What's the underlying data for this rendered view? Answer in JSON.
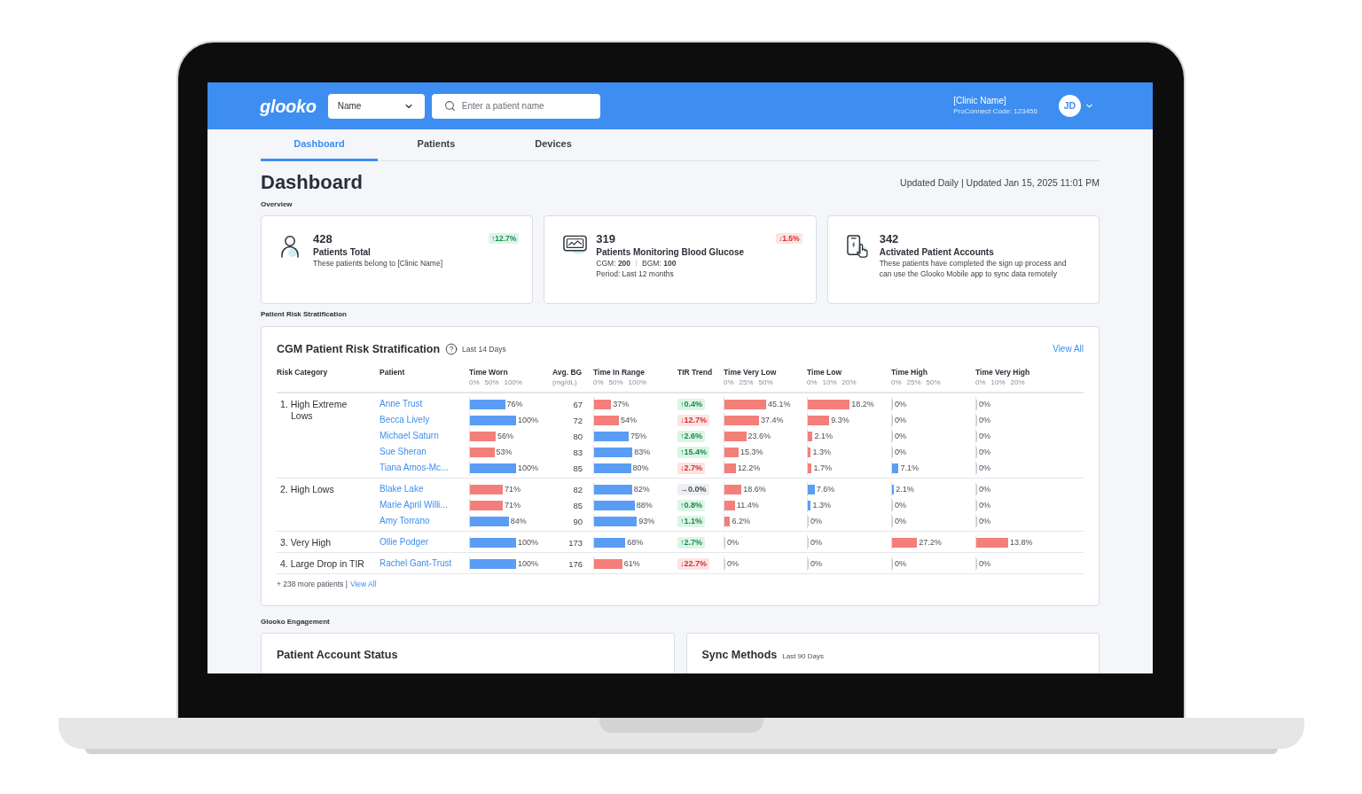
{
  "header": {
    "logo": "glooko",
    "search_by": {
      "value": "Name"
    },
    "search": {
      "placeholder": "Enter a patient name"
    },
    "clinic": {
      "name": "[Clinic Name]",
      "code": "ProConnect Code: 123456"
    },
    "avatar": "JD"
  },
  "tabs": [
    {
      "label": "Dashboard",
      "selected": true
    },
    {
      "label": "Patients",
      "selected": false
    },
    {
      "label": "Devices",
      "selected": false
    }
  ],
  "page": {
    "title": "Dashboard",
    "updated": "Updated Daily | Updated Jan 15, 2025 11:01 PM"
  },
  "overview": {
    "heading": "Overview",
    "cards": [
      {
        "value": "428",
        "title": "Patients Total",
        "description": "These patients belong to [Clinic Name]",
        "change": {
          "text": "↑12.7%",
          "kind": "rise"
        }
      },
      {
        "value": "319",
        "title": "Patients Monitoring Blood Glucose",
        "stats": [
          "CGM: **200**",
          "BGM: **100**"
        ],
        "description": "Period: Last 12 months",
        "change": {
          "text": "↓1.5%",
          "kind": "drop"
        }
      },
      {
        "value": "342",
        "title": "Activated Patient Accounts",
        "description": "These patients have completed the sign up process and can use the Glooko Mobile app to sync data remotely"
      }
    ]
  },
  "risk_heading": "Patient Risk Stratification",
  "risk_table": {
    "title": "CGM Patient Risk Stratification",
    "period": "Last 14 Days",
    "view_all": "View All",
    "columns": [
      {
        "label": "Risk Category"
      },
      {
        "label": "Patient"
      },
      {
        "label": "Time Worn",
        "scale": [
          "0%",
          "50%",
          "100%"
        ]
      },
      {
        "label": "Avg. BG",
        "unit": "(mg/dL)"
      },
      {
        "label": "Time In Range",
        "scale": [
          "0%",
          "50%",
          "100%"
        ]
      },
      {
        "label": "TIR Trend"
      },
      {
        "label": "Time Very Low",
        "scale": [
          "0%",
          "25%",
          "50%"
        ]
      },
      {
        "label": "Time Low",
        "scale": [
          "0%",
          "10%",
          "20%"
        ]
      },
      {
        "label": "Time High",
        "scale": [
          "0%",
          "25%",
          "50%"
        ]
      },
      {
        "label": "Time Very High",
        "scale": [
          "0%",
          "10%",
          "20%"
        ]
      }
    ],
    "groups": [
      {
        "category": "1. High Extreme Lows",
        "patients": [
          {
            "name": "Anne Trust",
            "metrics": [
              {
                "kind": "bar",
                "reading": "76%",
                "level": 0.76,
                "alert": false
              },
              {
                "kind": "number",
                "text": "67"
              },
              {
                "kind": "bar",
                "reading": "37%",
                "level": 0.37,
                "alert": true
              },
              {
                "kind": "rise",
                "text": "↑0.4%"
              },
              {
                "kind": "bar",
                "reading": "45.1%",
                "level": 0.902,
                "alert": true
              },
              {
                "kind": "bar",
                "reading": "18.2%",
                "level": 0.91,
                "alert": true
              },
              {
                "kind": "bar",
                "reading": "0%",
                "level": 0
              },
              {
                "kind": "bar",
                "reading": "0%",
                "level": 0
              }
            ]
          },
          {
            "name": "Becca Lively",
            "metrics": [
              {
                "kind": "bar",
                "reading": "100%",
                "level": 1,
                "alert": false
              },
              {
                "kind": "number",
                "text": "72"
              },
              {
                "kind": "bar",
                "reading": "54%",
                "level": 0.54,
                "alert": true
              },
              {
                "kind": "drop",
                "text": "↓12.7%"
              },
              {
                "kind": "bar",
                "reading": "37.4%",
                "level": 0.748,
                "alert": true
              },
              {
                "kind": "bar",
                "reading": "9.3%",
                "level": 0.465,
                "alert": true
              },
              {
                "kind": "bar",
                "reading": "0%",
                "level": 0
              },
              {
                "kind": "bar",
                "reading": "0%",
                "level": 0
              }
            ]
          },
          {
            "name": "Michael Saturn",
            "metrics": [
              {
                "kind": "bar",
                "reading": "56%",
                "level": 0.56,
                "alert": true
              },
              {
                "kind": "number",
                "text": "80"
              },
              {
                "kind": "bar",
                "reading": "75%",
                "level": 0.75,
                "alert": false
              },
              {
                "kind": "rise",
                "text": "↑2.6%"
              },
              {
                "kind": "bar",
                "reading": "23.6%",
                "level": 0.472,
                "alert": true
              },
              {
                "kind": "bar",
                "reading": "2.1%",
                "level": 0.105,
                "alert": true
              },
              {
                "kind": "bar",
                "reading": "0%",
                "level": 0
              },
              {
                "kind": "bar",
                "reading": "0%",
                "level": 0
              }
            ]
          },
          {
            "name": "Sue Sheran",
            "metrics": [
              {
                "kind": "bar",
                "reading": "53%",
                "level": 0.53,
                "alert": true
              },
              {
                "kind": "number",
                "text": "83"
              },
              {
                "kind": "bar",
                "reading": "83%",
                "level": 0.83,
                "alert": false
              },
              {
                "kind": "rise",
                "text": "↑15.4%"
              },
              {
                "kind": "bar",
                "reading": "15.3%",
                "level": 0.306,
                "alert": true
              },
              {
                "kind": "bar",
                "reading": "1.3%",
                "level": 0.065,
                "alert": true
              },
              {
                "kind": "bar",
                "reading": "0%",
                "level": 0
              },
              {
                "kind": "bar",
                "reading": "0%",
                "level": 0
              }
            ]
          },
          {
            "name": "Tiana Amos-Mc...",
            "metrics": [
              {
                "kind": "bar",
                "reading": "100%",
                "level": 1,
                "alert": false
              },
              {
                "kind": "number",
                "text": "85"
              },
              {
                "kind": "bar",
                "reading": "80%",
                "level": 0.8,
                "alert": false
              },
              {
                "kind": "drop",
                "text": "↓2.7%"
              },
              {
                "kind": "bar",
                "reading": "12.2%",
                "level": 0.244,
                "alert": true
              },
              {
                "kind": "bar",
                "reading": "1.7%",
                "level": 0.085,
                "alert": true
              },
              {
                "kind": "bar",
                "reading": "7.1%",
                "level": 0.142,
                "alert": false
              },
              {
                "kind": "bar",
                "reading": "0%",
                "level": 0
              }
            ]
          }
        ]
      },
      {
        "category": "2. High Lows",
        "patients": [
          {
            "name": "Blake Lake",
            "metrics": [
              {
                "kind": "bar",
                "reading": "71%",
                "level": 0.71,
                "alert": true
              },
              {
                "kind": "number",
                "text": "82"
              },
              {
                "kind": "bar",
                "reading": "82%",
                "level": 0.82,
                "alert": false
              },
              {
                "kind": "steady",
                "text": "→0.0%"
              },
              {
                "kind": "bar",
                "reading": "18.6%",
                "level": 0.372,
                "alert": true
              },
              {
                "kind": "bar",
                "reading": "7.6%",
                "level": 0.15,
                "alert": false
              },
              {
                "kind": "bar",
                "reading": "2.1%",
                "level": 0.042,
                "alert": false
              },
              {
                "kind": "bar",
                "reading": "0%",
                "level": 0
              }
            ]
          },
          {
            "name": "Marie April Willi...",
            "metrics": [
              {
                "kind": "bar",
                "reading": "71%",
                "level": 0.71,
                "alert": true
              },
              {
                "kind": "number",
                "text": "85"
              },
              {
                "kind": "bar",
                "reading": "88%",
                "level": 0.88,
                "alert": false
              },
              {
                "kind": "rise",
                "text": "↑0.8%"
              },
              {
                "kind": "bar",
                "reading": "11.4%",
                "level": 0.228,
                "alert": true
              },
              {
                "kind": "bar",
                "reading": "1.3%",
                "level": 0.065,
                "alert": false
              },
              {
                "kind": "bar",
                "reading": "0%",
                "level": 0
              },
              {
                "kind": "bar",
                "reading": "0%",
                "level": 0
              }
            ]
          },
          {
            "name": "Amy Torrano",
            "metrics": [
              {
                "kind": "bar",
                "reading": "84%",
                "level": 0.84,
                "alert": false
              },
              {
                "kind": "number",
                "text": "90"
              },
              {
                "kind": "bar",
                "reading": "93%",
                "level": 0.93,
                "alert": false
              },
              {
                "kind": "rise",
                "text": "↑1.1%"
              },
              {
                "kind": "bar",
                "reading": "6.2%",
                "level": 0.124,
                "alert": true
              },
              {
                "kind": "bar",
                "reading": "0%",
                "level": 0
              },
              {
                "kind": "bar",
                "reading": "0%",
                "level": 0
              },
              {
                "kind": "bar",
                "reading": "0%",
                "level": 0
              }
            ]
          }
        ]
      },
      {
        "category": "3. Very High",
        "patients": [
          {
            "name": "Ollie Podger",
            "metrics": [
              {
                "kind": "bar",
                "reading": "100%",
                "level": 1,
                "alert": false
              },
              {
                "kind": "number",
                "text": "173"
              },
              {
                "kind": "bar",
                "reading": "68%",
                "level": 0.68,
                "alert": false
              },
              {
                "kind": "rise",
                "text": "↑2.7%"
              },
              {
                "kind": "bar",
                "reading": "0%",
                "level": 0
              },
              {
                "kind": "bar",
                "reading": "0%",
                "level": 0
              },
              {
                "kind": "bar",
                "reading": "27.2%",
                "level": 0.544,
                "alert": true
              },
              {
                "kind": "bar",
                "reading": "13.8%",
                "level": 0.69,
                "alert": true
              }
            ]
          }
        ]
      },
      {
        "category": "4. Large Drop in TIR",
        "patients": [
          {
            "name": "Rachel Gant-Trust",
            "metrics": [
              {
                "kind": "bar",
                "reading": "100%",
                "level": 1,
                "alert": false
              },
              {
                "kind": "number",
                "text": "176"
              },
              {
                "kind": "bar",
                "reading": "61%",
                "level": 0.61,
                "alert": true
              },
              {
                "kind": "drop",
                "text": "↓22.7%"
              },
              {
                "kind": "bar",
                "reading": "0%",
                "level": 0
              },
              {
                "kind": "bar",
                "reading": "0%",
                "level": 0
              },
              {
                "kind": "bar",
                "reading": "0%",
                "level": 0
              },
              {
                "kind": "bar",
                "reading": "0%",
                "level": 0
              }
            ]
          }
        ]
      }
    ],
    "footer": {
      "text": "+ 238 more patients |",
      "link": "View All"
    }
  },
  "engagement": {
    "heading": "Glooko Engagement",
    "cards": [
      {
        "title": "Patient Account Status"
      },
      {
        "title": "Sync Methods",
        "period": "Last 90 Days"
      }
    ]
  }
}
